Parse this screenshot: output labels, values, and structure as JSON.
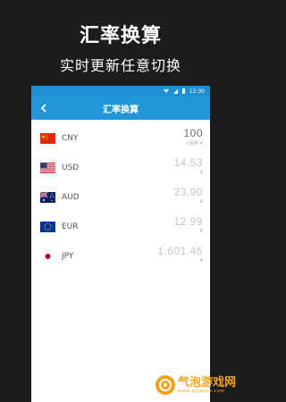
{
  "promo": {
    "title": "汇率换算",
    "subtitle": "实时更新任意切换"
  },
  "status_bar": {
    "time": "12:30"
  },
  "app_bar": {
    "title": "汇率换算",
    "back_icon": "chevron-left-icon"
  },
  "currencies": [
    {
      "code": "CNY",
      "value": "100",
      "unit": "人民币 ¥",
      "flag": "china-flag-icon"
    },
    {
      "code": "USD",
      "value": "14.53",
      "unit": "$",
      "flag": "usa-flag-icon"
    },
    {
      "code": "AUD",
      "value": "23.90",
      "unit": "$",
      "flag": "australia-flag-icon"
    },
    {
      "code": "EUR",
      "value": "12.99",
      "unit": "€",
      "flag": "eu-flag-icon"
    },
    {
      "code": "JPY",
      "value": "1,601.46",
      "unit": "¥",
      "flag": "japan-flag-icon"
    }
  ],
  "colors": {
    "accent": "#2196d9",
    "status_bar": "#1f8fd1",
    "background": "#1c1c1c"
  },
  "watermark": {
    "text": "气泡游戏网",
    "url": "www.qipaoxx.com"
  }
}
